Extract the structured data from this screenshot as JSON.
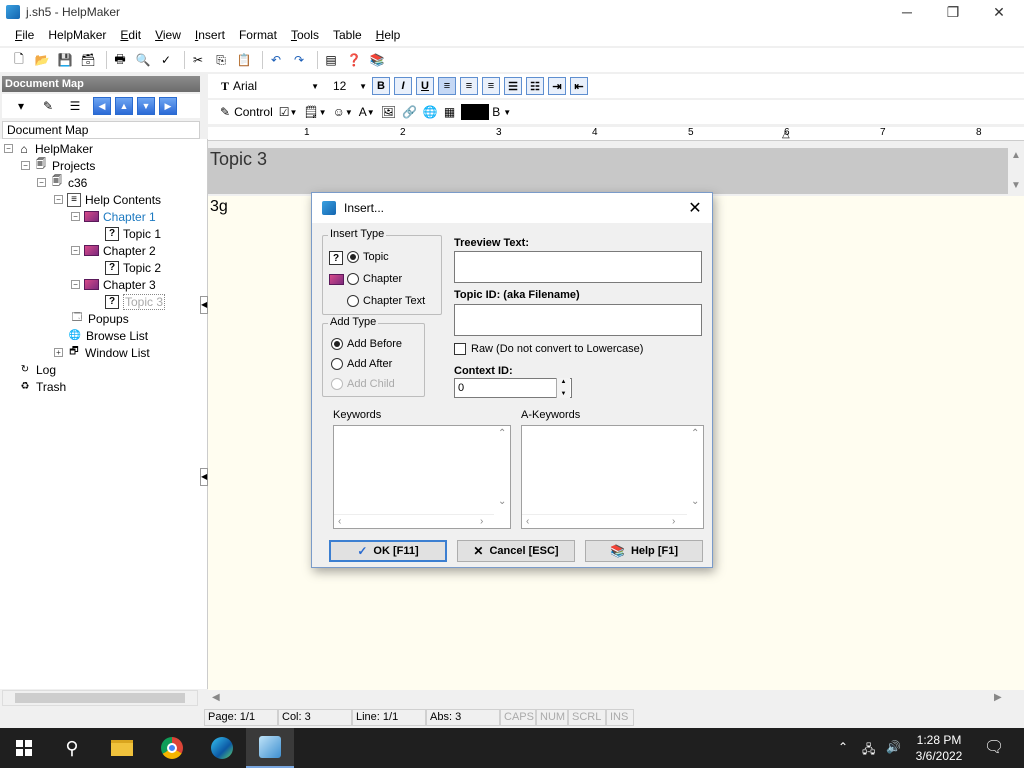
{
  "window": {
    "title": "j.sh5 - HelpMaker",
    "min": "─",
    "max": "❐",
    "close": "✕"
  },
  "menu": [
    {
      "label": "File",
      "u": "F",
      "rest": "ile"
    },
    {
      "label": "HelpMaker",
      "u": "",
      "rest": "HelpMaker"
    },
    {
      "label": "Edit",
      "u": "E",
      "rest": "dit"
    },
    {
      "label": "View",
      "u": "V",
      "rest": "iew"
    },
    {
      "label": "Insert",
      "u": "I",
      "rest": "nsert"
    },
    {
      "label": "Format",
      "u": "",
      "rest": "Format"
    },
    {
      "label": "Tools",
      "u": "T",
      "rest": "ools"
    },
    {
      "label": "Table",
      "u": "",
      "rest": "Table"
    },
    {
      "label": "Help",
      "u": "H",
      "rest": "elp"
    }
  ],
  "docmap": {
    "header": "Document Map",
    "label": "Document Map"
  },
  "tree": {
    "root": "HelpMaker",
    "projects": "Projects",
    "project": "c36",
    "help_contents": "Help Contents",
    "chapter1": "Chapter 1",
    "topic1": "Topic 1",
    "chapter2": "Chapter 2",
    "topic2": "Topic 2",
    "chapter3": "Chapter 3",
    "topic3": "Topic 3",
    "popups": "Popups",
    "browse_list": "Browse List",
    "window_list": "Window List",
    "log": "Log",
    "trash": "Trash"
  },
  "format": {
    "font": "Arial",
    "size": "12",
    "control_label": "Control",
    "color_label": "B"
  },
  "ruler": [
    "1",
    "2",
    "3",
    "4",
    "5",
    "6",
    "7",
    "8"
  ],
  "topic_title": "Topic 3",
  "editor_text": "3g",
  "status": {
    "page": "Page: 1/1",
    "col": "Col: 3",
    "line": "Line: 1/1",
    "abs": "Abs: 3",
    "caps": "CAPS",
    "num": "NUM",
    "scrl": "SCRL",
    "ins": "INS"
  },
  "taskbar": {
    "time": "1:28 PM",
    "date": "3/6/2022"
  },
  "dialog": {
    "title": "Insert...",
    "insert_type_legend": "Insert Type",
    "opt_topic": "Topic",
    "opt_chapter": "Chapter",
    "opt_chapter_text": "Chapter Text",
    "add_type_legend": "Add Type",
    "opt_add_before": "Add Before",
    "opt_add_after": "Add After",
    "opt_add_child": "Add Child",
    "treeview_label": "Treeview Text:",
    "treeview_value": "",
    "topic_id_label": "Topic ID: (aka Filename)",
    "topic_id_value": "",
    "raw_label": "Raw (Do not convert to Lowercase)",
    "context_label": "Context ID:",
    "context_value": "0",
    "keywords_label": "Keywords",
    "akeywords_label": "A-Keywords",
    "ok_label": "OK [F11]",
    "cancel_label": "Cancel [ESC]",
    "help_label": "Help [F1]"
  }
}
